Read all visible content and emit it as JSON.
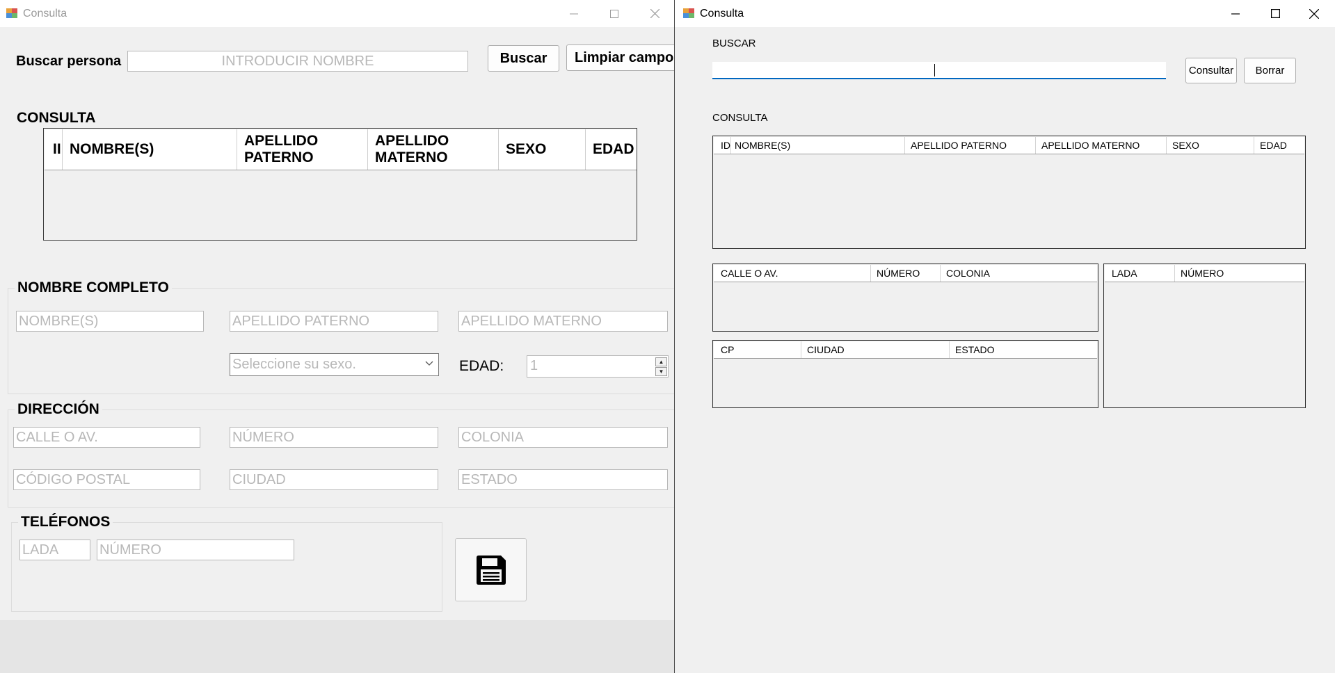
{
  "left_window": {
    "title": "Consulta",
    "search": {
      "label": "Buscar persona",
      "placeholder": "INTRODUCIR NOMBRE",
      "search_button": "Buscar",
      "clear_button": "Limpiar campos"
    },
    "consulta_title": "CONSULTA",
    "grid_columns": [
      "II",
      "NOMBRE(S)",
      "APELLIDO PATERNO",
      "APELLIDO MATERNO",
      "SEXO",
      "EDAD"
    ],
    "nombre_group": {
      "title": "NOMBRE COMPLETO",
      "nombre_placeholder": "NOMBRE(S)",
      "paterno_placeholder": "APELLIDO PATERNO",
      "materno_placeholder": "APELLIDO MATERNO",
      "sexo_placeholder": "Seleccione su sexo.",
      "edad_label": "EDAD:",
      "edad_value": "1"
    },
    "direccion_group": {
      "title": "DIRECCIÓN",
      "calle_placeholder": "CALLE O AV.",
      "numero_placeholder": "NÚMERO",
      "colonia_placeholder": "COLONIA",
      "cp_placeholder": "CÓDIGO POSTAL",
      "ciudad_placeholder": "CIUDAD",
      "estado_placeholder": "ESTADO"
    },
    "telefonos_group": {
      "title": "TELÉFONOS",
      "lada_placeholder": "LADA",
      "numero_placeholder": "NÚMERO"
    },
    "save_icon": "floppy-disk-icon"
  },
  "right_window": {
    "title": "Consulta",
    "buscar_label": "BUSCAR",
    "search_value": "",
    "consultar_button": "Consultar",
    "borrar_button": "Borrar",
    "consulta_label": "CONSULTA",
    "main_grid_columns": [
      "ID",
      "NOMBRE(S)",
      "APELLIDO PATERNO",
      "APELLIDO MATERNO",
      "SEXO",
      "EDAD"
    ],
    "address_grid_columns": [
      "CALLE O AV.",
      "NÚMERO",
      "COLONIA"
    ],
    "city_grid_columns": [
      "CP",
      "CIUDAD",
      "ESTADO"
    ],
    "phone_grid_columns": [
      "LADA",
      "NÚMERO"
    ]
  },
  "colors": {
    "focus_accent": "#0067c0",
    "window_background": "#f0f0f0",
    "placeholder_text": "#b8b8b8"
  }
}
